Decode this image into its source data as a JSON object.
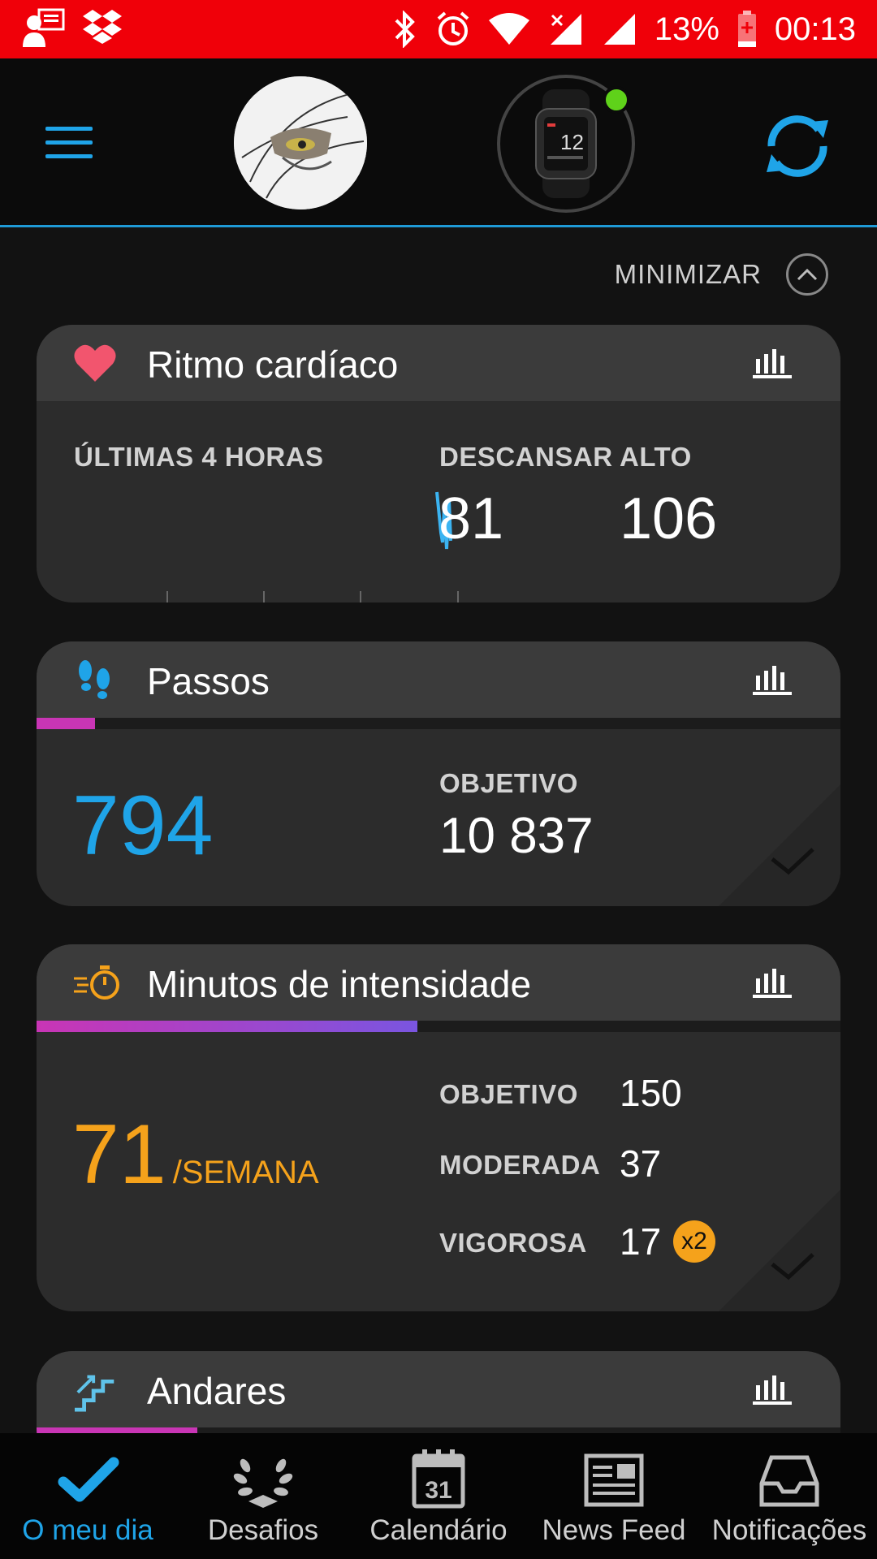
{
  "status_bar": {
    "battery": "13%",
    "time": "00:13"
  },
  "header": {
    "menu_icon": "hamburger-menu-icon",
    "avatar": "profile-avatar",
    "device": "watch-device",
    "device_status_color": "#5fd21a",
    "sync_icon": "sync-icon"
  },
  "minimize": {
    "label": "MINIMIZAR"
  },
  "cards": {
    "heart": {
      "title": "Ritmo cardíaco",
      "icon": "heart-icon",
      "range_label": "ÚLTIMAS 4 HORAS",
      "rest_label": "DESCANSAR",
      "rest_value": "81",
      "high_label": "ALTO",
      "high_value": "106"
    },
    "steps": {
      "title": "Passos",
      "icon": "footsteps-icon",
      "value": "794",
      "goal_label": "OBJETIVO",
      "goal_value": "10 837",
      "progress": 0.07
    },
    "intensity": {
      "title": "Minutos de intensidade",
      "icon": "stopwatch-icon",
      "value": "71",
      "unit": "/SEMANA",
      "goal_label": "OBJETIVO",
      "goal_value": "150",
      "moderate_label": "MODERADA",
      "moderate_value": "37",
      "vigorous_label": "VIGOROSA",
      "vigorous_value": "17",
      "vigorous_badge": "x2",
      "progress": 0.47
    },
    "floors": {
      "title": "Andares",
      "icon": "stairs-icon",
      "progress": 0.2
    }
  },
  "bottom_nav": [
    {
      "label": "O meu dia",
      "icon": "checkmark-icon",
      "active": true
    },
    {
      "label": "Desafios",
      "icon": "laurel-icon",
      "active": false
    },
    {
      "label": "Calendário",
      "icon": "calendar-icon",
      "active": false,
      "calendar_day": "31"
    },
    {
      "label": "News Feed",
      "icon": "newspaper-icon",
      "active": false
    },
    {
      "label": "Notificações",
      "icon": "inbox-icon",
      "active": false
    }
  ],
  "colors": {
    "accent_blue": "#1fa4e8",
    "status_bar_red": "#f00009",
    "steps_blue": "#1fa4e8",
    "intensity_orange": "#f5a21b",
    "heart_pink": "#f2556e",
    "progress_magenta": "#c935b5",
    "progress_purple": "#7a55e0"
  }
}
